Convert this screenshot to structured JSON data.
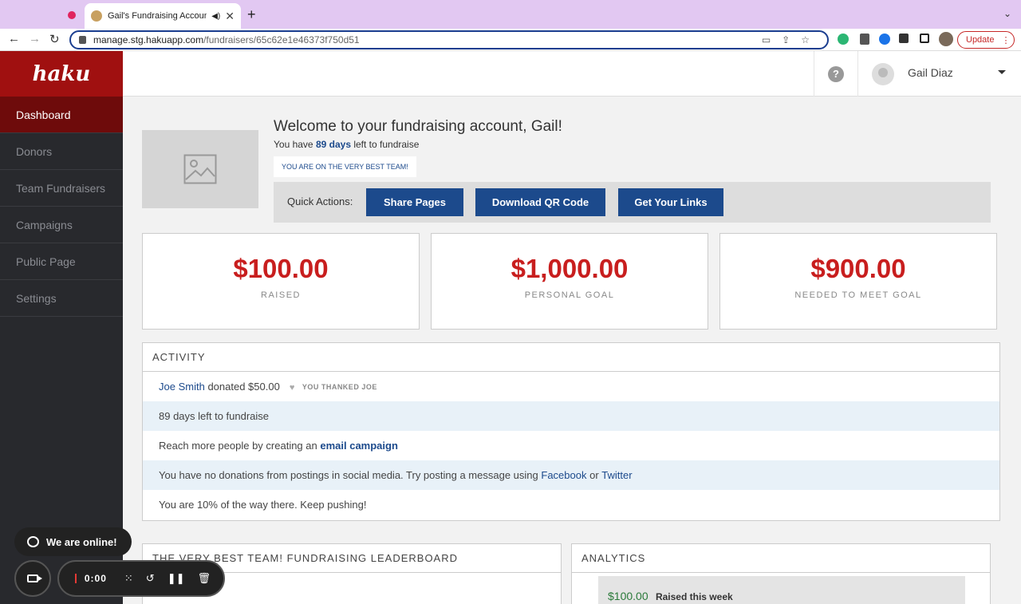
{
  "browser": {
    "tab_title": "Gail's Fundraising Account",
    "url_host": "manage.stg.hakuapp.com",
    "url_path": "/fundraisers/65c62e1e46373f750d51",
    "update_label": "Update"
  },
  "sidebar": {
    "logo": "haku",
    "items": [
      {
        "label": "Dashboard"
      },
      {
        "label": "Donors"
      },
      {
        "label": "Team Fundraisers"
      },
      {
        "label": "Campaigns"
      },
      {
        "label": "Public Page"
      },
      {
        "label": "Settings"
      }
    ]
  },
  "header": {
    "help_icon": "?",
    "user_name": "Gail Diaz"
  },
  "welcome": {
    "title": "Welcome to your fundraising account, Gail!",
    "days_prefix": "You have",
    "days_value": "89 days",
    "days_suffix": "left to fundraise",
    "team_badge": "YOU ARE ON THE VERY BEST TEAM!"
  },
  "quick_actions": {
    "label": "Quick Actions:",
    "buttons": [
      "Share Pages",
      "Download QR Code",
      "Get Your Links"
    ]
  },
  "stats": [
    {
      "value": "$100.00",
      "label": "RAISED"
    },
    {
      "value": "$1,000.00",
      "label": "PERSONAL GOAL"
    },
    {
      "value": "$900.00",
      "label": "NEEDED TO MEET GOAL"
    }
  ],
  "activity": {
    "title": "ACTIVITY",
    "row1": {
      "donor": "Joe Smith",
      "text": "donated $50.00",
      "thanked": "YOU THANKED JOE"
    },
    "row2": {
      "text": "89 days left to fundraise"
    },
    "row3": {
      "text": "Reach more people by creating an",
      "link": "email campaign"
    },
    "row4": {
      "text": "You have no donations from postings in social media. Try posting a message using",
      "link1": "Facebook",
      "mid": "or",
      "link2": "Twitter"
    },
    "row5": {
      "text": "You are 10% of the way there. Keep pushing!"
    }
  },
  "leaderboard": {
    "title": "THE VERY BEST TEAM! FUNDRAISING LEADERBOARD"
  },
  "analytics": {
    "title": "ANALYTICS",
    "amount": "$100.00",
    "label": "Raised this week"
  },
  "overlay": {
    "chat_label": "We are online!",
    "timer": "0:00"
  },
  "colors": {
    "brand_red": "#a01010",
    "sidebar_active": "#6e0b0b",
    "primary_blue": "#1c4a8c",
    "stat_red": "#c81e1e",
    "analytics_green": "#2a7a3a"
  }
}
